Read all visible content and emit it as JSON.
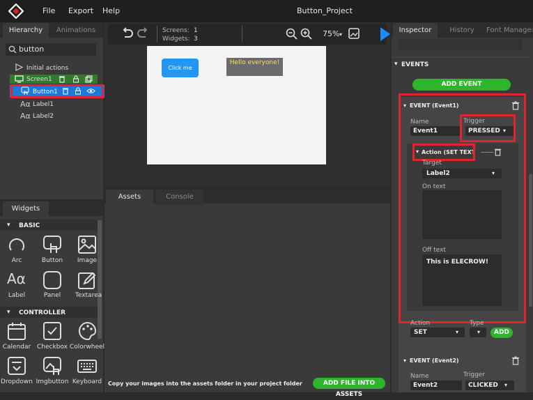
{
  "menu": {
    "file": "File",
    "export": "Export",
    "help": "Help"
  },
  "window_title": "Button_Project",
  "hierarchy": {
    "tabs": [
      "Hierarchy",
      "Animations"
    ],
    "search_value": "button",
    "items": [
      "Initial actions",
      "Screen1",
      "Button1",
      "Label1",
      "Label2"
    ]
  },
  "toolbar": {
    "screens_label": "Screens:",
    "screens_value": "1",
    "widgets_label": "Widgets:",
    "widgets_value": "3",
    "zoom": "75%"
  },
  "canvas": {
    "button_text": "Click me",
    "label_text": "Hello everyone!"
  },
  "widgets": {
    "tab": "Widgets",
    "basic_title": "BASIC",
    "basic_items": [
      "Arc",
      "Button",
      "Image",
      "Label",
      "Panel",
      "Textarea"
    ],
    "controller_title": "CONTROLLER",
    "controller_items": [
      "Calendar",
      "Checkbox",
      "Colorwheel",
      "Dropdown",
      "Imgbutton",
      "Keyboard"
    ]
  },
  "assets": {
    "tabs": [
      "Assets",
      "Console"
    ],
    "hint": "Copy your images into the assets folder in your project folder",
    "add_button": "ADD FILE INTO ASSETS"
  },
  "inspector": {
    "tabs": [
      "Inspector",
      "History",
      "Font Manager"
    ],
    "events_title": "EVENTS",
    "add_event": "ADD EVENT",
    "event1": {
      "title": "EVENT (Event1)",
      "name_label": "Name",
      "name_value": "Event1",
      "trigger_label": "Trigger",
      "trigger_value": "PRESSED",
      "action_title": "Action (SET TEXT",
      "target_label": "Target",
      "target_value": "Label2",
      "on_text_label": "On text",
      "on_text_value": "",
      "off_text_label": "Off text",
      "off_text_value": "This is ELECROW!",
      "action_label": "Action",
      "action_value": "SET",
      "type_label": "Type",
      "add_label": "ADD"
    },
    "event2": {
      "title": "EVENT (Event2)",
      "name_label": "Name",
      "name_value": "Event2",
      "trigger_label": "Trigger",
      "trigger_value": "CLICKED"
    }
  },
  "colors": {
    "accent_blue": "#1a8cff",
    "green": "#2eb52b",
    "highlight_red": "#e0252e",
    "selected_row": "#1e78d7",
    "screen_row": "#2f7a2c"
  }
}
